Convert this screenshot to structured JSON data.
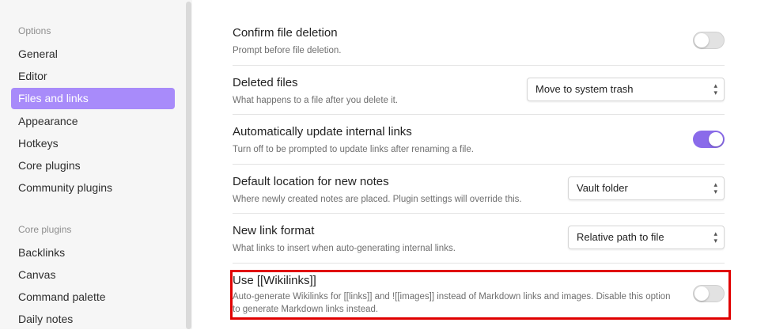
{
  "sidebar": {
    "options_title": "Options",
    "options_items": [
      "General",
      "Editor",
      "Files and links",
      "Appearance",
      "Hotkeys",
      "Core plugins",
      "Community plugins"
    ],
    "active_item": "Files and links",
    "core_title": "Core plugins",
    "core_items": [
      "Backlinks",
      "Canvas",
      "Command palette",
      "Daily notes"
    ]
  },
  "settings": {
    "confirm_deletion": {
      "name": "Confirm file deletion",
      "desc": "Prompt before file deletion.",
      "enabled": false
    },
    "deleted_files": {
      "name": "Deleted files",
      "desc": "What happens to a file after you delete it.",
      "value": "Move to system trash"
    },
    "auto_update_links": {
      "name": "Automatically update internal links",
      "desc": "Turn off to be prompted to update links after renaming a file.",
      "enabled": true
    },
    "default_location": {
      "name": "Default location for new notes",
      "desc": "Where newly created notes are placed. Plugin settings will override this.",
      "value": "Vault folder"
    },
    "link_format": {
      "name": "New link format",
      "desc": "What links to insert when auto-generating internal links.",
      "value": "Relative path to file"
    },
    "wikilinks": {
      "name": "Use [[Wikilinks]]",
      "desc": "Auto-generate Wikilinks for [[links]] and ![[images]] instead of Markdown links and images. Disable this option to generate Markdown links instead.",
      "enabled": false
    }
  },
  "colors": {
    "accent": "#8a6bea",
    "active_nav": "#a88bfa",
    "highlight_box": "#e00000"
  }
}
